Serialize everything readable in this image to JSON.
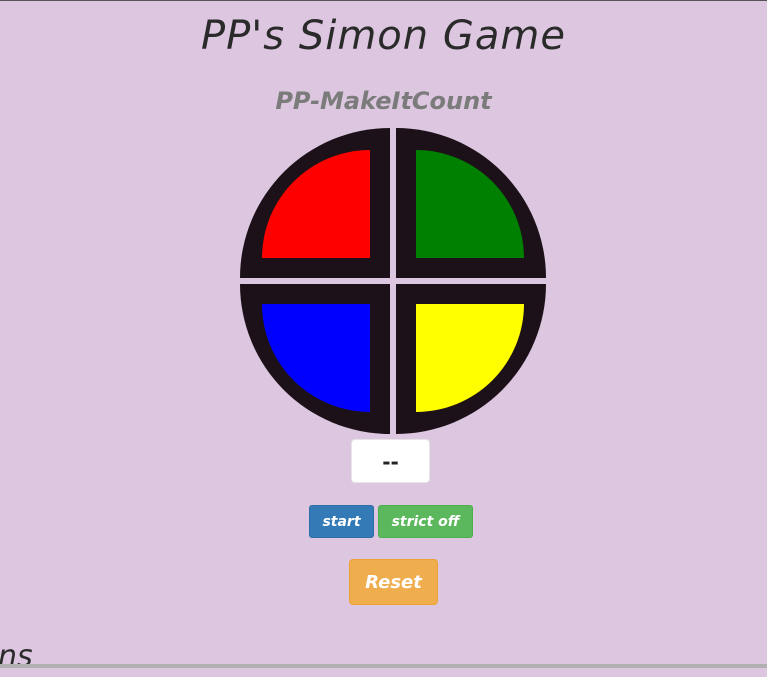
{
  "header": {
    "title": "PP's Simon Game",
    "subtitle": "PP-MakeItCount"
  },
  "board": {
    "pads": [
      {
        "id": "red",
        "color": "#ff0000"
      },
      {
        "id": "green",
        "color": "#008000"
      },
      {
        "id": "blue",
        "color": "#0000ff"
      },
      {
        "id": "yellow",
        "color": "#ffff00"
      }
    ]
  },
  "counter": {
    "value": "--"
  },
  "controls": {
    "start_label": "start",
    "strict_label": "strict off",
    "reset_label": "Reset"
  },
  "footer": {
    "partial_heading": "ns"
  }
}
